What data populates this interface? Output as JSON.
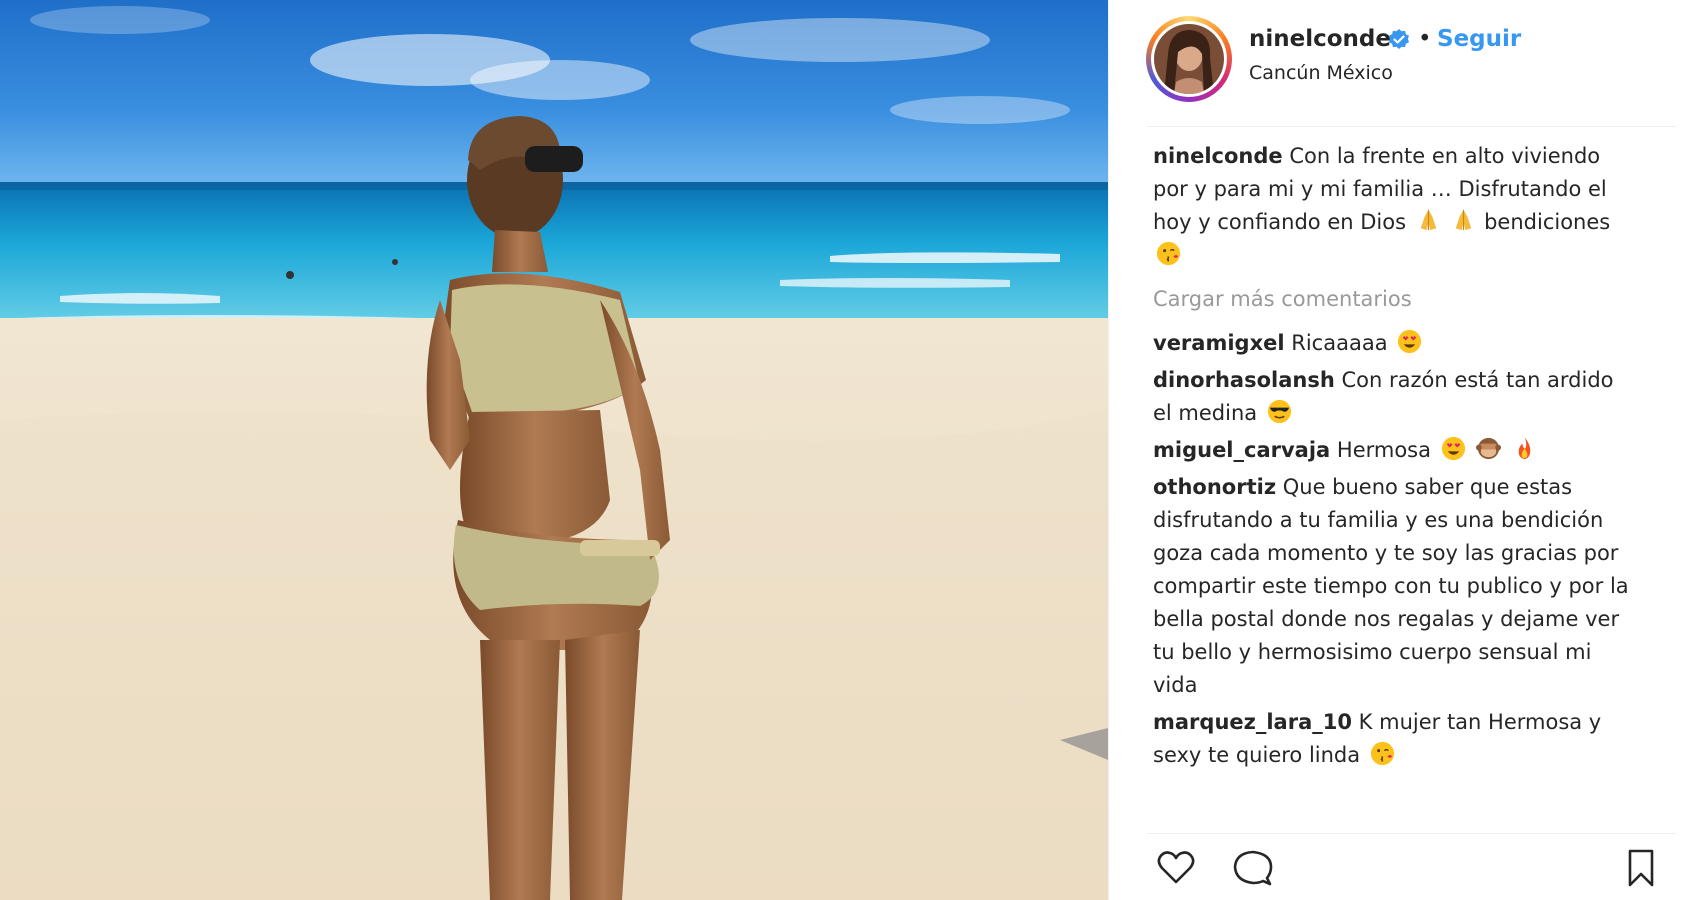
{
  "post": {
    "username": "ninelconde",
    "separator": "•",
    "follow_label": "Seguir",
    "location": "Cancún México"
  },
  "caption": {
    "username": "ninelconde",
    "text": "Con la frente en alto viviendo por y para mi y mi familia … Disfrutando el hoy y confiando en Dios",
    "text_after": "bendiciones"
  },
  "load_more_label": "Cargar más comentarios",
  "comments": [
    {
      "username": "veramigxel",
      "text": "Ricaaaaa"
    },
    {
      "username": "dinorhasolansh",
      "text": "Con razón está tan ardido el medina"
    },
    {
      "username": "miguel_carvaja",
      "text": "Hermosa"
    },
    {
      "username": "othonortiz",
      "text": "Que bueno saber que estas disfrutando a tu familia y es una bendición goza cada momento y te soy las gracias por compartir este tiempo con tu publico y por la bella postal donde nos regalas y dejame ver tu bello y hermosisimo cuerpo sensual mi vida"
    },
    {
      "username": "marquez_lara_10",
      "text": "K mujer tan Hermosa y sexy te quiero linda"
    }
  ],
  "icons": {
    "verified": "verified-badge-icon",
    "like": "heart-icon",
    "comment": "comment-bubble-icon",
    "save": "bookmark-icon"
  },
  "colors": {
    "link_blue": "#3897f0",
    "text": "#262626",
    "muted": "#999999"
  }
}
